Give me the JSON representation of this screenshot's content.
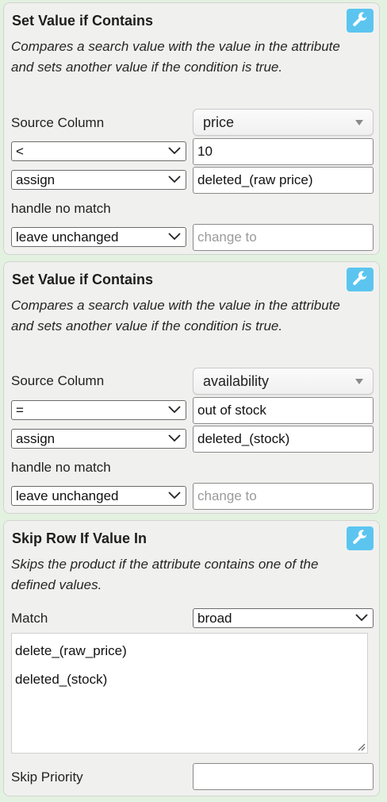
{
  "panels": [
    {
      "title": "Set Value if Contains",
      "description": "Compares a search value with the value in the attribute and sets another value if the condition is true.",
      "source_column_label": "Source Column",
      "source_column_value": "price",
      "operator": "<",
      "search_value": "10",
      "action": "assign",
      "action_value": "deleted_(raw price)",
      "no_match_label": "handle no match",
      "no_match_option": "leave unchanged",
      "change_to_placeholder": "change to"
    },
    {
      "title": "Set Value if Contains",
      "description": "Compares a search value with the value in the attribute and sets another value if the condition is true.",
      "source_column_label": "Source Column",
      "source_column_value": "availability",
      "operator": "=",
      "search_value": "out of stock",
      "action": "assign",
      "action_value": "deleted_(stock)",
      "no_match_label": "handle no match",
      "no_match_option": "leave unchanged",
      "change_to_placeholder": "change to"
    },
    {
      "title": "Skip Row If Value In",
      "description": "Skips the product if the attribute contains one of the defined values.",
      "match_label": "Match",
      "match_value": "broad",
      "values": [
        "delete_(raw_price)",
        "deleted_(stock)"
      ],
      "skip_priority_label": "Skip Priority",
      "skip_priority_value": ""
    }
  ],
  "icons": {
    "settings": "wrench-icon",
    "dropdown": "chevron-down-icon",
    "popup": "triangle-down-icon",
    "resize": "resize-grip-icon"
  },
  "colors": {
    "background": "#e3f1e1",
    "panel": "#f0f1ef",
    "accent": "#5bc5f0"
  }
}
